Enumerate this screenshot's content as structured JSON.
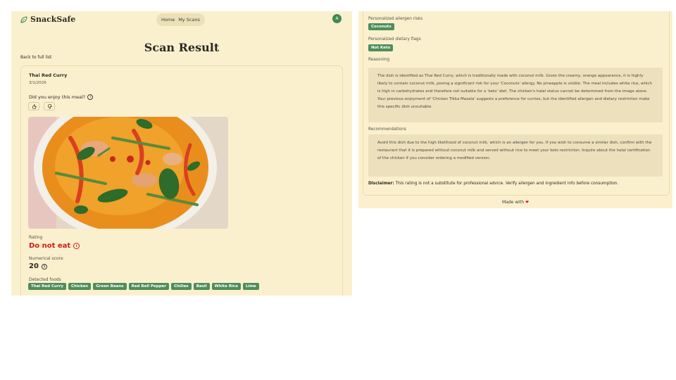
{
  "app": {
    "name": "SnackSafe",
    "avatar_initial": "A"
  },
  "nav": {
    "home": "Home",
    "my_scans": "My Scans"
  },
  "page": {
    "title": "Scan Result",
    "back_link": "Back to full list"
  },
  "scan": {
    "food_name": "Thai Red Curry",
    "date": "3/1/2026",
    "enjoy_question": "Did you enjoy this meal?",
    "rating_label": "Rating",
    "rating_value": "Do not eat",
    "score_label": "Numerical score",
    "score_value": "20",
    "detected_label": "Detected foods",
    "detected_foods": [
      "Thai Red Curry",
      "Chicken",
      "Green Beans",
      "Red Bell Pepper",
      "Chilies",
      "Basil",
      "White Rice",
      "Lime"
    ]
  },
  "details": {
    "allergen_label": "Personalized allergen risks",
    "allergens": [
      "Coconuts"
    ],
    "dietary_label": "Personalized dietary flags",
    "dietary_flags": [
      "Not Keto"
    ],
    "reasoning_label": "Reasoning",
    "reasoning_text": "The dish is identified as Thai Red Curry, which is traditionally made with coconut milk. Given the creamy, orange appearance, it is highly likely to contain coconut milk, posing a significant risk for your 'Coconuts' allergy. No pineapple is visible. The meal includes white rice, which is high in carbohydrates and therefore not suitable for a 'keto' diet. The chicken's halal status cannot be determined from the image alone. Your previous enjoyment of 'Chicken Tikka Masala' suggests a preference for curries, but the identified allergen and dietary restriction make this specific dish unsuitable.",
    "recommendations_label": "Recommendations",
    "recommendations_text": "Avoid this dish due to the high likelihood of coconut milk, which is an allergen for you. If you wish to consume a similar dish, confirm with the restaurant that it is prepared without coconut milk and served without rice to meet your keto restriction. Inquire about the halal certification of the chicken if you consider ordering a modified version.",
    "disclaimer_label": "Disclaimer:",
    "disclaimer_text": "This rating is not a substitute for professional advice. Verify allergen and ingredient info before consumption."
  },
  "footer": {
    "text": "Made with",
    "heart": "❤"
  },
  "colors": {
    "background": "#fbf0ce",
    "accent_green": "#4f8d5b",
    "danger_red": "#d11a1a"
  }
}
